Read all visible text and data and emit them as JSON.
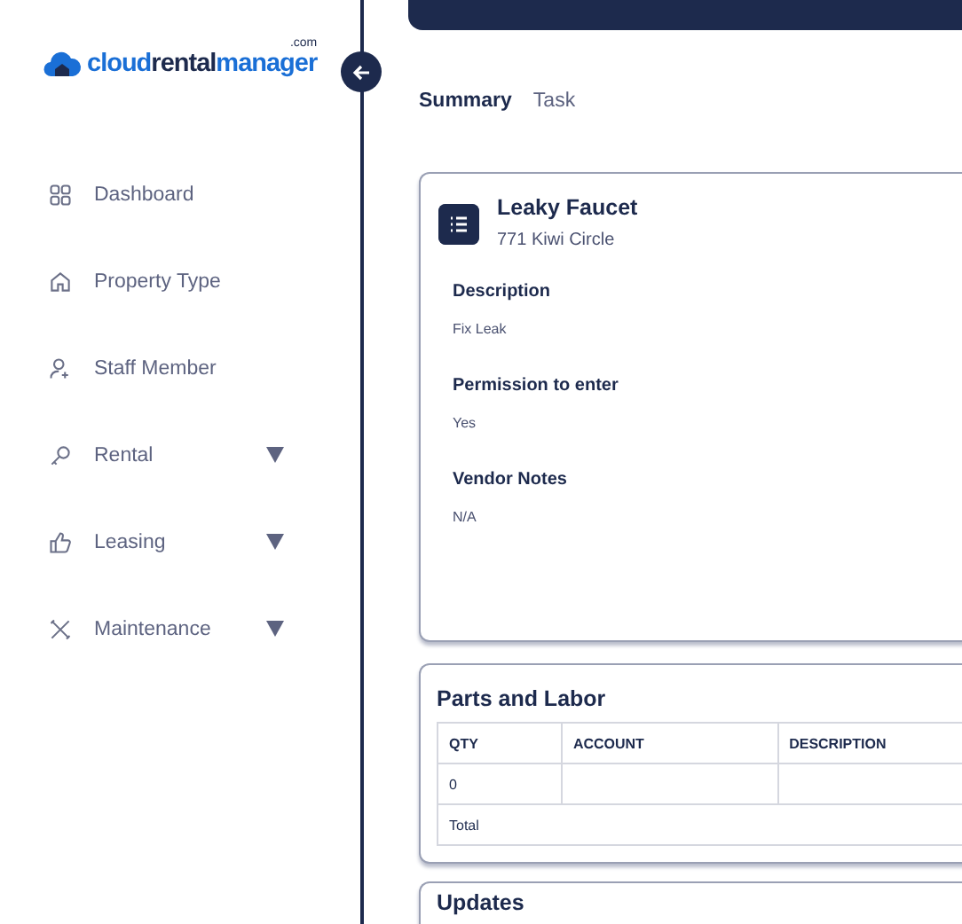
{
  "logo": {
    "parts": [
      "cloud",
      "rental",
      "manager"
    ],
    "suffix": ".com"
  },
  "sidebar": {
    "items": [
      {
        "label": "Dashboard",
        "has_submenu": false
      },
      {
        "label": "Property Type",
        "has_submenu": false
      },
      {
        "label": "Staff Member",
        "has_submenu": false
      },
      {
        "label": "Rental",
        "has_submenu": true
      },
      {
        "label": "Leasing",
        "has_submenu": true
      },
      {
        "label": "Maintenance",
        "has_submenu": true
      }
    ]
  },
  "tabs": [
    {
      "label": "Summary",
      "selected": true
    },
    {
      "label": "Task",
      "selected": false
    }
  ],
  "summary_card": {
    "title": "Leaky Faucet",
    "address": "771 Kiwi Circle",
    "fields": [
      {
        "label": "Description",
        "value": "Fix Leak"
      },
      {
        "label": "Permission to enter",
        "value": "Yes"
      },
      {
        "label": "Vendor Notes",
        "value": "N/A"
      }
    ]
  },
  "parts_card": {
    "title": "Parts and Labor",
    "table": {
      "columns": [
        "QTY",
        "ACCOUNT",
        "DESCRIPTION"
      ],
      "rows": [
        [
          "0",
          "",
          ""
        ]
      ],
      "footer": "Total"
    }
  },
  "updates_card": {
    "title": "Updates"
  }
}
